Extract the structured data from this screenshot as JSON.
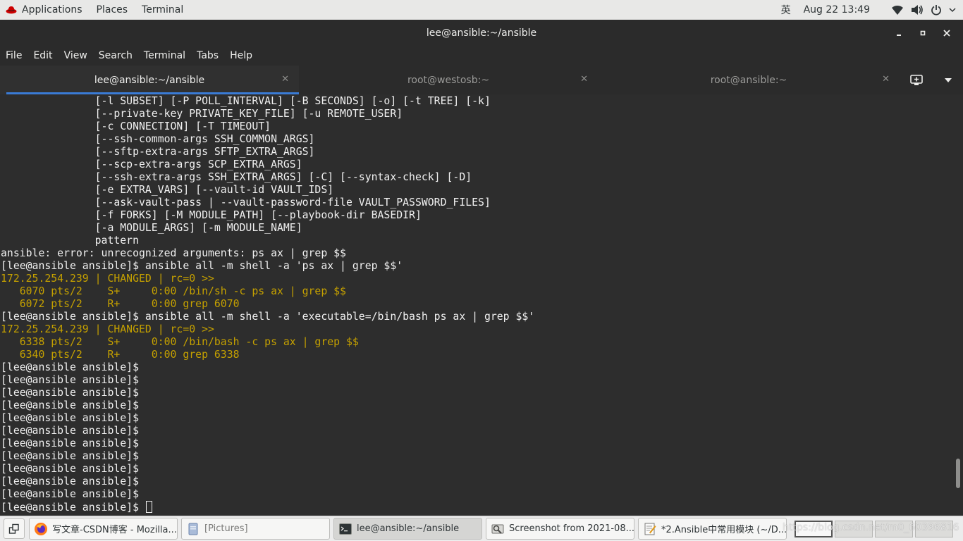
{
  "topbar": {
    "applications": "Applications",
    "places": "Places",
    "terminal": "Terminal",
    "lang": "英",
    "datetime": "Aug 22  13:49",
    "icons": [
      "wifi-icon",
      "volume-icon",
      "power-icon"
    ]
  },
  "window": {
    "title": "lee@ansible:~/ansible"
  },
  "menu": [
    "File",
    "Edit",
    "View",
    "Search",
    "Terminal",
    "Tabs",
    "Help"
  ],
  "tabs": [
    {
      "label": "lee@ansible:~/ansible",
      "active": true
    },
    {
      "label": "root@westosb:~",
      "active": false
    },
    {
      "label": "root@ansible:~",
      "active": false
    }
  ],
  "terminal": {
    "lines": [
      {
        "text": "               [-l SUBSET] [-P POLL_INTERVAL] [-B SECONDS] [-o] [-t TREE] [-k]",
        "color": "default"
      },
      {
        "text": "               [--private-key PRIVATE_KEY_FILE] [-u REMOTE_USER]",
        "color": "default"
      },
      {
        "text": "               [-c CONNECTION] [-T TIMEOUT]",
        "color": "default"
      },
      {
        "text": "               [--ssh-common-args SSH_COMMON_ARGS]",
        "color": "default"
      },
      {
        "text": "               [--sftp-extra-args SFTP_EXTRA_ARGS]",
        "color": "default"
      },
      {
        "text": "               [--scp-extra-args SCP_EXTRA_ARGS]",
        "color": "default"
      },
      {
        "text": "               [--ssh-extra-args SSH_EXTRA_ARGS] [-C] [--syntax-check] [-D]",
        "color": "default"
      },
      {
        "text": "               [-e EXTRA_VARS] [--vault-id VAULT_IDS]",
        "color": "default"
      },
      {
        "text": "               [--ask-vault-pass | --vault-password-file VAULT_PASSWORD_FILES]",
        "color": "default"
      },
      {
        "text": "               [-f FORKS] [-M MODULE_PATH] [--playbook-dir BASEDIR]",
        "color": "default"
      },
      {
        "text": "               [-a MODULE_ARGS] [-m MODULE_NAME]",
        "color": "default"
      },
      {
        "text": "               pattern",
        "color": "default"
      },
      {
        "text": "ansible: error: unrecognized arguments: ps ax | grep $$",
        "color": "default"
      },
      {
        "text": "[lee@ansible ansible]$ ansible all -m shell -a 'ps ax | grep $$'",
        "color": "default"
      },
      {
        "text": "172.25.254.239 | CHANGED | rc=0 >>",
        "color": "yellow"
      },
      {
        "text": "   6070 pts/2    S+     0:00 /bin/sh -c ps ax | grep $$",
        "color": "yellow"
      },
      {
        "text": "   6072 pts/2    R+     0:00 grep 6070",
        "color": "yellow"
      },
      {
        "text": "[lee@ansible ansible]$ ansible all -m shell -a 'executable=/bin/bash ps ax | grep $$'",
        "color": "default"
      },
      {
        "text": "172.25.254.239 | CHANGED | rc=0 >>",
        "color": "yellow"
      },
      {
        "text": "   6338 pts/2    S+     0:00 /bin/bash -c ps ax | grep $$",
        "color": "yellow"
      },
      {
        "text": "   6340 pts/2    R+     0:00 grep 6338",
        "color": "yellow"
      },
      {
        "text": "[lee@ansible ansible]$",
        "color": "default"
      },
      {
        "text": "[lee@ansible ansible]$",
        "color": "default"
      },
      {
        "text": "[lee@ansible ansible]$",
        "color": "default"
      },
      {
        "text": "[lee@ansible ansible]$",
        "color": "default"
      },
      {
        "text": "[lee@ansible ansible]$",
        "color": "default"
      },
      {
        "text": "[lee@ansible ansible]$",
        "color": "default"
      },
      {
        "text": "[lee@ansible ansible]$",
        "color": "default"
      },
      {
        "text": "[lee@ansible ansible]$",
        "color": "default"
      },
      {
        "text": "[lee@ansible ansible]$",
        "color": "default"
      },
      {
        "text": "[lee@ansible ansible]$",
        "color": "default"
      },
      {
        "text": "[lee@ansible ansible]$",
        "color": "default"
      },
      {
        "text": "[lee@ansible ansible]$ ",
        "color": "default",
        "cursor": true
      }
    ],
    "scroll_position": 0.93,
    "scroll_visible_fraction": 0.07,
    "colors": {
      "foreground": "#f0f0f0",
      "yellow": "#c4a000",
      "background": "#2d2d2d"
    }
  },
  "taskbar": {
    "items": [
      {
        "label": "写文章-CSDN博客 - Mozilla...",
        "icon": "firefox-icon",
        "active": false
      },
      {
        "label": "[Pictures]",
        "icon": "folder-icon",
        "active": false
      },
      {
        "label": "lee@ansible:~/ansible",
        "icon": "terminal-icon",
        "active": true
      },
      {
        "label": "Screenshot from 2021-08...",
        "icon": "image-viewer-icon",
        "active": false
      },
      {
        "label": "*2.Ansible中常用模块 (~/D...",
        "icon": "text-editor-icon",
        "active": false
      }
    ],
    "workspaces": 4,
    "active_workspace": 1
  },
  "watermark": "https://blog.csdn.net/m0_60396816"
}
